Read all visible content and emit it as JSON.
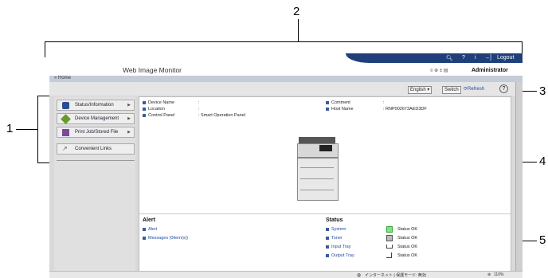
{
  "callouts": {
    "c1": "1",
    "c2": "2",
    "c3": "3",
    "c4": "4",
    "c5": "5"
  },
  "header": {
    "title": "Web Image Monitor",
    "logout": "Logout",
    "user": "Administrator",
    "breadcrumb": "« Home"
  },
  "toolbar": {
    "language": "English",
    "switch": "Switch",
    "refresh": "Refresh",
    "help": "?"
  },
  "sidebar": {
    "items": [
      {
        "label": "Status/Information",
        "icon": "info-icon"
      },
      {
        "label": "Device Management",
        "icon": "device-management-icon"
      },
      {
        "label": "Print Job/Stored File",
        "icon": "document-icon"
      },
      {
        "label": "Convenient Links",
        "icon": "link-icon"
      }
    ]
  },
  "device_info": {
    "device_name_label": "Device Name",
    "device_name_value": ":",
    "location_label": "Location",
    "location_value": ":",
    "control_panel_label": "Control Panel",
    "control_panel_value": ": Smart Operation Panel",
    "comment_label": "Comment",
    "comment_value": ":",
    "host_name_label": "Host Name",
    "host_name_value": ": RNP002673AED3DF"
  },
  "alert": {
    "heading": "Alert",
    "links": [
      "Alert",
      "Messages (0item(s))"
    ]
  },
  "status": {
    "heading": "Status",
    "rows": [
      {
        "name": "System",
        "value": "Status OK"
      },
      {
        "name": "Toner",
        "value": "Status OK"
      },
      {
        "name": "Input Tray",
        "value": "Status OK"
      },
      {
        "name": "Output Tray",
        "value": "Status OK"
      }
    ]
  },
  "statusbar": {
    "zone": "インターネット | 保護モード: 無効",
    "zoom": "110%"
  }
}
